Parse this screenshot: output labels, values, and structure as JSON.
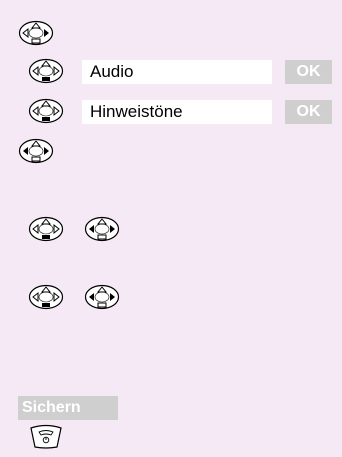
{
  "steps": [
    {
      "nav_icons": [
        "nav-key-down-icon"
      ]
    },
    {
      "nav_icons": [
        "nav-key-up-down-icon"
      ],
      "label": "Audio",
      "softkey": "OK"
    },
    {
      "nav_icons": [
        "nav-key-up-down-icon"
      ],
      "label": "Hinweistöne",
      "softkey": "OK"
    },
    {
      "nav_icons": [
        "nav-key-left-right-icon"
      ]
    },
    {
      "nav_icons": [
        "nav-key-up-down-icon",
        "nav-key-left-right-icon"
      ]
    },
    {
      "nav_icons": [
        "nav-key-up-down-icon",
        "nav-key-left-right-icon"
      ]
    }
  ],
  "save_softkey": {
    "label": "Sichern"
  },
  "end_key_icon": "end-call-key-icon",
  "colors": {
    "panel_bg": "#f6e9f6",
    "softkey_bg": "#cfcfcf",
    "softkey_text": "#ffffff"
  }
}
